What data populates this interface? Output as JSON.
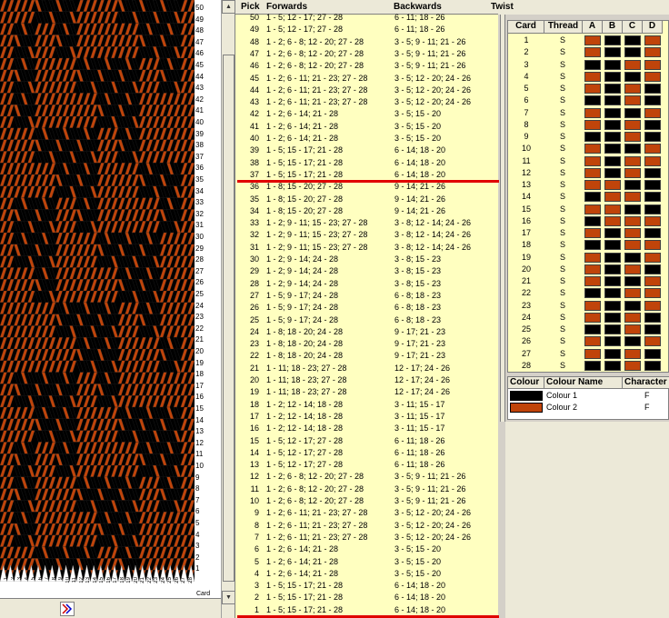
{
  "colors": {
    "colour1": "#000000",
    "colour2": "#c0440a",
    "list_bg": "#ffffc0",
    "red_line": "#e00000"
  },
  "list": {
    "headers": {
      "pick": "Pick",
      "forwards": "Forwards",
      "backwards": "Backwards",
      "twist": "Twist"
    },
    "rows": [
      {
        "pick": "50",
        "fwd": "1 - 5; 12 - 17; 27 - 28",
        "bwd": "6 - 11; 18 - 26"
      },
      {
        "pick": "49",
        "fwd": "1 - 5; 12 - 17; 27 - 28",
        "bwd": "6 - 11; 18 - 26"
      },
      {
        "pick": "48",
        "fwd": "1 - 2; 6 - 8; 12 - 20; 27 - 28",
        "bwd": "3 - 5; 9 - 11; 21 - 26"
      },
      {
        "pick": "47",
        "fwd": "1 - 2; 6 - 8; 12 - 20; 27 - 28",
        "bwd": "3 - 5; 9 - 11; 21 - 26"
      },
      {
        "pick": "46",
        "fwd": "1 - 2; 6 - 8; 12 - 20; 27 - 28",
        "bwd": "3 - 5; 9 - 11; 21 - 26"
      },
      {
        "pick": "45",
        "fwd": "1 - 2; 6 - 11; 21 - 23; 27 - 28",
        "bwd": "3 - 5; 12 - 20; 24 - 26"
      },
      {
        "pick": "44",
        "fwd": "1 - 2; 6 - 11; 21 - 23; 27 - 28",
        "bwd": "3 - 5; 12 - 20; 24 - 26"
      },
      {
        "pick": "43",
        "fwd": "1 - 2; 6 - 11; 21 - 23; 27 - 28",
        "bwd": "3 - 5; 12 - 20; 24 - 26"
      },
      {
        "pick": "42",
        "fwd": "1 - 2; 6 - 14; 21 - 28",
        "bwd": "3 - 5; 15 - 20"
      },
      {
        "pick": "41",
        "fwd": "1 - 2; 6 - 14; 21 - 28",
        "bwd": "3 - 5; 15 - 20"
      },
      {
        "pick": "40",
        "fwd": "1 - 2; 6 - 14; 21 - 28",
        "bwd": "3 - 5; 15 - 20"
      },
      {
        "pick": "39",
        "fwd": "1 - 5; 15 - 17; 21 - 28",
        "bwd": "6 - 14; 18 - 20"
      },
      {
        "pick": "38",
        "fwd": "1 - 5; 15 - 17; 21 - 28",
        "bwd": "6 - 14; 18 - 20"
      },
      {
        "pick": "37",
        "fwd": "1 - 5; 15 - 17; 21 - 28",
        "bwd": "6 - 14; 18 - 20"
      },
      {
        "pick": "36",
        "fwd": "1 - 8; 15 - 20; 27 - 28",
        "bwd": "9 - 14; 21 - 26"
      },
      {
        "pick": "35",
        "fwd": "1 - 8; 15 - 20; 27 - 28",
        "bwd": "9 - 14; 21 - 26"
      },
      {
        "pick": "34",
        "fwd": "1 - 8; 15 - 20; 27 - 28",
        "bwd": "9 - 14; 21 - 26"
      },
      {
        "pick": "33",
        "fwd": "1 - 2; 9 - 11; 15 - 23; 27 - 28",
        "bwd": "3 - 8; 12 - 14; 24 - 26"
      },
      {
        "pick": "32",
        "fwd": "1 - 2; 9 - 11; 15 - 23; 27 - 28",
        "bwd": "3 - 8; 12 - 14; 24 - 26"
      },
      {
        "pick": "31",
        "fwd": "1 - 2; 9 - 11; 15 - 23; 27 - 28",
        "bwd": "3 - 8; 12 - 14; 24 - 26"
      },
      {
        "pick": "30",
        "fwd": "1 - 2; 9 - 14; 24 - 28",
        "bwd": "3 - 8; 15 - 23"
      },
      {
        "pick": "29",
        "fwd": "1 - 2; 9 - 14; 24 - 28",
        "bwd": "3 - 8; 15 - 23"
      },
      {
        "pick": "28",
        "fwd": "1 - 2; 9 - 14; 24 - 28",
        "bwd": "3 - 8; 15 - 23"
      },
      {
        "pick": "27",
        "fwd": "1 - 5; 9 - 17; 24 - 28",
        "bwd": "6 - 8; 18 - 23"
      },
      {
        "pick": "26",
        "fwd": "1 - 5; 9 - 17; 24 - 28",
        "bwd": "6 - 8; 18 - 23"
      },
      {
        "pick": "25",
        "fwd": "1 - 5; 9 - 17; 24 - 28",
        "bwd": "6 - 8; 18 - 23"
      },
      {
        "pick": "24",
        "fwd": "1 - 8; 18 - 20; 24 - 28",
        "bwd": "9 - 17; 21 - 23"
      },
      {
        "pick": "23",
        "fwd": "1 - 8; 18 - 20; 24 - 28",
        "bwd": "9 - 17; 21 - 23"
      },
      {
        "pick": "22",
        "fwd": "1 - 8; 18 - 20; 24 - 28",
        "bwd": "9 - 17; 21 - 23"
      },
      {
        "pick": "21",
        "fwd": "1 - 11; 18 - 23; 27 - 28",
        "bwd": "12 - 17; 24 - 26"
      },
      {
        "pick": "20",
        "fwd": "1 - 11; 18 - 23; 27 - 28",
        "bwd": "12 - 17; 24 - 26"
      },
      {
        "pick": "19",
        "fwd": "1 - 11; 18 - 23; 27 - 28",
        "bwd": "12 - 17; 24 - 26"
      },
      {
        "pick": "18",
        "fwd": "1 - 2; 12 - 14; 18 - 28",
        "bwd": "3 - 11; 15 - 17"
      },
      {
        "pick": "17",
        "fwd": "1 - 2; 12 - 14; 18 - 28",
        "bwd": "3 - 11; 15 - 17"
      },
      {
        "pick": "16",
        "fwd": "1 - 2; 12 - 14; 18 - 28",
        "bwd": "3 - 11; 15 - 17"
      },
      {
        "pick": "15",
        "fwd": "1 - 5; 12 - 17; 27 - 28",
        "bwd": "6 - 11; 18 - 26"
      },
      {
        "pick": "14",
        "fwd": "1 - 5; 12 - 17; 27 - 28",
        "bwd": "6 - 11; 18 - 26"
      },
      {
        "pick": "13",
        "fwd": "1 - 5; 12 - 17; 27 - 28",
        "bwd": "6 - 11; 18 - 26"
      },
      {
        "pick": "12",
        "fwd": "1 - 2; 6 - 8; 12 - 20; 27 - 28",
        "bwd": "3 - 5; 9 - 11; 21 - 26"
      },
      {
        "pick": "11",
        "fwd": "1 - 2; 6 - 8; 12 - 20; 27 - 28",
        "bwd": "3 - 5; 9 - 11; 21 - 26"
      },
      {
        "pick": "10",
        "fwd": "1 - 2; 6 - 8; 12 - 20; 27 - 28",
        "bwd": "3 - 5; 9 - 11; 21 - 26"
      },
      {
        "pick": "9",
        "fwd": "1 - 2; 6 - 11; 21 - 23; 27 - 28",
        "bwd": "3 - 5; 12 - 20; 24 - 26"
      },
      {
        "pick": "8",
        "fwd": "1 - 2; 6 - 11; 21 - 23; 27 - 28",
        "bwd": "3 - 5; 12 - 20; 24 - 26"
      },
      {
        "pick": "7",
        "fwd": "1 - 2; 6 - 11; 21 - 23; 27 - 28",
        "bwd": "3 - 5; 12 - 20; 24 - 26"
      },
      {
        "pick": "6",
        "fwd": "1 - 2; 6 - 14; 21 - 28",
        "bwd": "3 - 5; 15 - 20"
      },
      {
        "pick": "5",
        "fwd": "1 - 2; 6 - 14; 21 - 28",
        "bwd": "3 - 5; 15 - 20"
      },
      {
        "pick": "4",
        "fwd": "1 - 2; 6 - 14; 21 - 28",
        "bwd": "3 - 5; 15 - 20"
      },
      {
        "pick": "3",
        "fwd": "1 - 5; 15 - 17; 21 - 28",
        "bwd": "6 - 14; 18 - 20"
      },
      {
        "pick": "2",
        "fwd": "1 - 5; 15 - 17; 21 - 28",
        "bwd": "6 - 14; 18 - 20"
      },
      {
        "pick": "1",
        "fwd": "1 - 5; 15 - 17; 21 - 28",
        "bwd": "6 - 14; 18 - 20"
      }
    ]
  },
  "cards": {
    "headers": {
      "card": "Card",
      "thread": "Thread",
      "a": "A",
      "b": "B",
      "c": "C",
      "d": "D"
    },
    "rows": [
      {
        "card": "1",
        "thread": "S",
        "holes": [
          1,
          0,
          0,
          1
        ]
      },
      {
        "card": "2",
        "thread": "S",
        "holes": [
          1,
          0,
          0,
          1
        ]
      },
      {
        "card": "3",
        "thread": "S",
        "holes": [
          0,
          0,
          1,
          1
        ]
      },
      {
        "card": "4",
        "thread": "S",
        "holes": [
          1,
          0,
          0,
          1
        ]
      },
      {
        "card": "5",
        "thread": "S",
        "holes": [
          1,
          0,
          1,
          0
        ]
      },
      {
        "card": "6",
        "thread": "S",
        "holes": [
          0,
          0,
          1,
          0
        ]
      },
      {
        "card": "7",
        "thread": "S",
        "holes": [
          1,
          0,
          0,
          1
        ]
      },
      {
        "card": "8",
        "thread": "S",
        "holes": [
          1,
          0,
          1,
          0
        ]
      },
      {
        "card": "9",
        "thread": "S",
        "holes": [
          0,
          0,
          1,
          0
        ]
      },
      {
        "card": "10",
        "thread": "S",
        "holes": [
          1,
          0,
          0,
          1
        ]
      },
      {
        "card": "11",
        "thread": "S",
        "holes": [
          1,
          0,
          1,
          1
        ]
      },
      {
        "card": "12",
        "thread": "S",
        "holes": [
          1,
          0,
          1,
          0
        ]
      },
      {
        "card": "13",
        "thread": "S",
        "holes": [
          1,
          1,
          0,
          0
        ]
      },
      {
        "card": "14",
        "thread": "S",
        "holes": [
          0,
          1,
          1,
          0
        ]
      },
      {
        "card": "15",
        "thread": "S",
        "holes": [
          1,
          1,
          0,
          0
        ]
      },
      {
        "card": "16",
        "thread": "S",
        "holes": [
          0,
          1,
          1,
          1
        ]
      },
      {
        "card": "17",
        "thread": "S",
        "holes": [
          1,
          0,
          1,
          0
        ]
      },
      {
        "card": "18",
        "thread": "S",
        "holes": [
          0,
          0,
          1,
          1
        ]
      },
      {
        "card": "19",
        "thread": "S",
        "holes": [
          1,
          0,
          0,
          1
        ]
      },
      {
        "card": "20",
        "thread": "S",
        "holes": [
          1,
          0,
          1,
          0
        ]
      },
      {
        "card": "21",
        "thread": "S",
        "holes": [
          1,
          0,
          0,
          1
        ]
      },
      {
        "card": "22",
        "thread": "S",
        "holes": [
          0,
          0,
          1,
          1
        ]
      },
      {
        "card": "23",
        "thread": "S",
        "holes": [
          1,
          0,
          0,
          1
        ]
      },
      {
        "card": "24",
        "thread": "S",
        "holes": [
          1,
          0,
          1,
          0
        ]
      },
      {
        "card": "25",
        "thread": "S",
        "holes": [
          0,
          0,
          1,
          0
        ]
      },
      {
        "card": "26",
        "thread": "S",
        "holes": [
          1,
          0,
          0,
          1
        ]
      },
      {
        "card": "27",
        "thread": "S",
        "holes": [
          1,
          0,
          1,
          0
        ]
      },
      {
        "card": "28",
        "thread": "S",
        "holes": [
          0,
          0,
          1,
          0
        ]
      }
    ]
  },
  "colours": {
    "headers": {
      "colour": "Colour",
      "name": "Colour Name",
      "character": "Character"
    },
    "rows": [
      {
        "name": "Colour 1",
        "char": "F",
        "color": "#000000"
      },
      {
        "name": "Colour 2",
        "char": "F",
        "color": "#c0440a"
      }
    ]
  },
  "pattern": {
    "card_label": "Card",
    "cards": 28,
    "picks": 50
  }
}
